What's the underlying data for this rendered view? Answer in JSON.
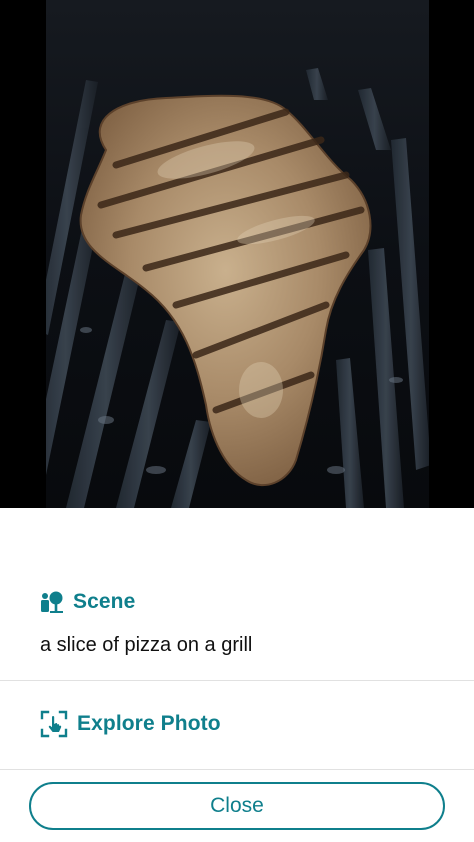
{
  "scene": {
    "icon": "scene-icon",
    "label": "Scene",
    "caption": "a slice of pizza on a grill"
  },
  "explore": {
    "icon": "explore-photo-icon",
    "label": "Explore Photo"
  },
  "close_label": "Close",
  "colors": {
    "accent": "#0f7f8c",
    "panel_background": "#ffffff",
    "photo_background": "#000000"
  }
}
